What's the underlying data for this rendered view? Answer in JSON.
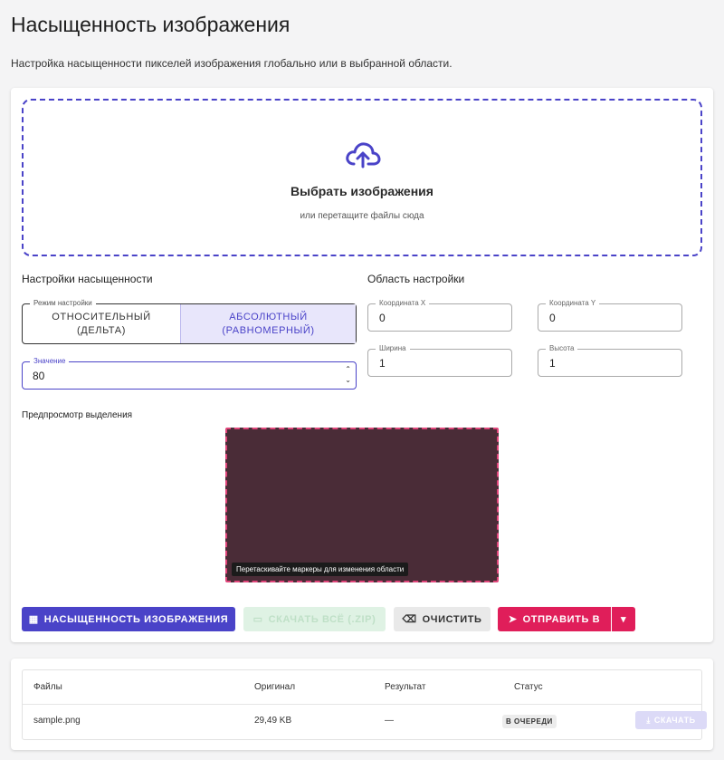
{
  "page": {
    "title": "Насыщенность изображения",
    "description": "Настройка насыщенности пикселей изображения глобально или в выбранной области."
  },
  "dropzone": {
    "icon": "cloud-upload-icon",
    "title": "Выбрать изображения",
    "subtitle": "или перетащите файлы сюда"
  },
  "saturation": {
    "heading": "Настройки насыщенности",
    "mode_legend": "Режим настройки",
    "modes": [
      {
        "label_line1": "ОТНОСИТЕЛЬНЫЙ",
        "label_line2": "(ДЕЛЬТА)",
        "selected": false
      },
      {
        "label_line1": "АБСОЛЮТНЫЙ",
        "label_line2": "(РАВНОМЕРНЫЙ)",
        "selected": true
      }
    ],
    "value_legend": "Значение",
    "value": "80"
  },
  "region": {
    "heading": "Область настройки",
    "x_label": "Координата X",
    "x_value": "0",
    "y_label": "Координата Y",
    "y_value": "0",
    "w_label": "Ширина",
    "w_value": "1",
    "h_label": "Высота",
    "h_value": "1"
  },
  "preview": {
    "label": "Предпросмотр выделения",
    "hint": "Перетаскивайте маркеры для изменения области"
  },
  "actions": {
    "process_label": "НАСЫЩЕННОСТЬ ИЗОБРАЖЕНИЯ",
    "download_all_label": "СКАЧАТЬ ВСЁ (.ZIP)",
    "clear_label": "ОЧИСТИТЬ",
    "send_label": "ОТПРАВИТЬ В"
  },
  "files": {
    "columns": [
      "Файлы",
      "Оригинал",
      "Результат",
      "Статус"
    ],
    "rows": [
      {
        "name": "sample.png",
        "original": "29,49 KB",
        "result": "—",
        "status": "В ОЧЕРЕДИ",
        "download_label": "СКАЧАТЬ"
      }
    ]
  },
  "colors": {
    "accent": "#4a43c8",
    "send": "#e01e5a",
    "preview_bg": "#4a2c37"
  }
}
